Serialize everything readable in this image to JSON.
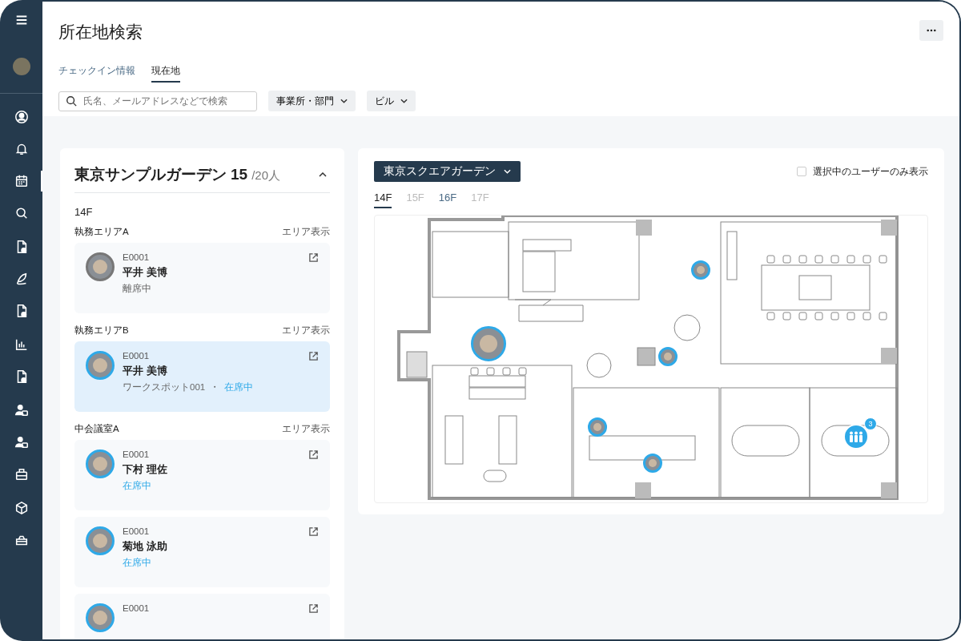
{
  "page": {
    "title": "所在地検索"
  },
  "sidebar": {
    "groups": [
      {
        "items": [
          {
            "selected": false
          },
          {
            "selected": false
          },
          {
            "selected": true
          },
          {
            "selected": false
          }
        ]
      },
      {
        "items": [
          {
            "selected": false
          },
          {
            "selected": false
          },
          {
            "selected": false
          }
        ]
      },
      {
        "items": [
          {
            "selected": false
          },
          {
            "selected": false
          }
        ]
      },
      {
        "items": [
          {
            "selected": false
          },
          {
            "selected": false
          },
          {
            "selected": false
          }
        ]
      },
      {
        "items": [
          {
            "selected": false
          },
          {
            "selected": false
          }
        ]
      }
    ]
  },
  "tabs": [
    {
      "label": "チェックイン情報",
      "selected": false
    },
    {
      "label": "現在地",
      "selected": true
    }
  ],
  "search": {
    "placeholder": "氏名、メールアドレスなどで検索"
  },
  "filters": [
    "事業所・部門",
    "ビル"
  ],
  "panel": {
    "title": "東京サンプルガーデン",
    "count": "15",
    "total": "/20人",
    "expanded": true,
    "floor": "14F",
    "areas": [
      {
        "name": "執務エリアA",
        "link": "エリア表示",
        "people": [
          {
            "id": "E0001",
            "name": "平井 美博",
            "status": "離席中",
            "present": false,
            "selected": false
          }
        ]
      },
      {
        "name": "執務エリアB",
        "link": "エリア表示",
        "people": [
          {
            "id": "E0001",
            "name": "平井 美博",
            "location": "ワークスポット001",
            "separator": "・",
            "status": "在席中",
            "present": true,
            "selected": true
          }
        ]
      },
      {
        "name": "中会議室A",
        "link": "エリア表示",
        "people": [
          {
            "id": "E0001",
            "name": "下村 理佐",
            "status": "在席中",
            "present": true,
            "selected": false
          },
          {
            "id": "E0001",
            "name": "菊地 泳助",
            "status": "在席中",
            "present": true,
            "selected": false
          },
          {
            "id": "E0001",
            "present": true,
            "selected": false
          }
        ]
      }
    ]
  },
  "map": {
    "building": "東京スクエアガーデン",
    "only_selected": {
      "label": "選択中のユーザーのみ表示",
      "checked": false
    },
    "floors": [
      {
        "label": "14F",
        "selected": true,
        "disabled": false
      },
      {
        "label": "15F",
        "selected": false,
        "disabled": true
      },
      {
        "label": "16F",
        "selected": false,
        "disabled": false
      },
      {
        "label": "17F",
        "selected": false,
        "disabled": true
      }
    ],
    "pins": [
      {
        "kind": "focused"
      },
      {
        "kind": "person"
      },
      {
        "kind": "person"
      },
      {
        "kind": "person"
      },
      {
        "kind": "person"
      },
      {
        "kind": "group",
        "count": "3"
      }
    ]
  }
}
